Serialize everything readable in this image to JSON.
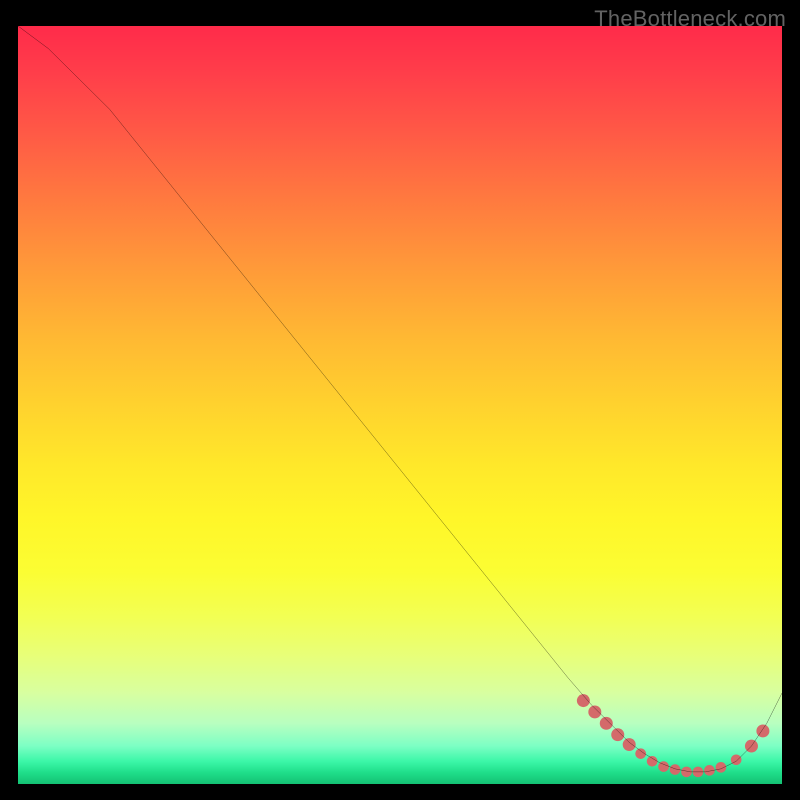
{
  "watermark": "TheBottleneck.com",
  "chart_data": {
    "type": "line",
    "title": "",
    "xlabel": "",
    "ylabel": "",
    "xlim": [
      0,
      100
    ],
    "ylim": [
      0,
      100
    ],
    "grid": false,
    "legend": false,
    "gradient_stops": [
      {
        "pos": 0,
        "color": "#ff2b4a"
      },
      {
        "pos": 50,
        "color": "#ffd22e"
      },
      {
        "pos": 78,
        "color": "#f2ff54"
      },
      {
        "pos": 100,
        "color": "#14c173"
      }
    ],
    "series": [
      {
        "name": "bottleneck-curve",
        "color": "#000000",
        "x": [
          0,
          4,
          8,
          12,
          20,
          30,
          40,
          50,
          60,
          68,
          72,
          75,
          78,
          80,
          82,
          84,
          86,
          88,
          90,
          92,
          94,
          96,
          98,
          100
        ],
        "y": [
          100,
          97,
          93,
          89,
          79,
          66.5,
          54,
          41.5,
          29,
          19,
          14,
          10.5,
          7.5,
          5.5,
          4,
          2.8,
          2,
          1.6,
          1.6,
          2,
          3,
          5,
          8,
          12
        ]
      }
    ],
    "markers": {
      "name": "highlight-band",
      "color": "#d46a6a",
      "points": [
        {
          "x": 74,
          "y": 11
        },
        {
          "x": 75.5,
          "y": 9.5
        },
        {
          "x": 77,
          "y": 8
        },
        {
          "x": 78.5,
          "y": 6.5
        },
        {
          "x": 80,
          "y": 5.2
        },
        {
          "x": 81.5,
          "y": 4
        },
        {
          "x": 83,
          "y": 3
        },
        {
          "x": 84.5,
          "y": 2.3
        },
        {
          "x": 86,
          "y": 1.9
        },
        {
          "x": 87.5,
          "y": 1.6
        },
        {
          "x": 89,
          "y": 1.6
        },
        {
          "x": 90.5,
          "y": 1.8
        },
        {
          "x": 92,
          "y": 2.2
        },
        {
          "x": 94,
          "y": 3.2
        },
        {
          "x": 96,
          "y": 5
        },
        {
          "x": 97.5,
          "y": 7
        }
      ]
    }
  }
}
